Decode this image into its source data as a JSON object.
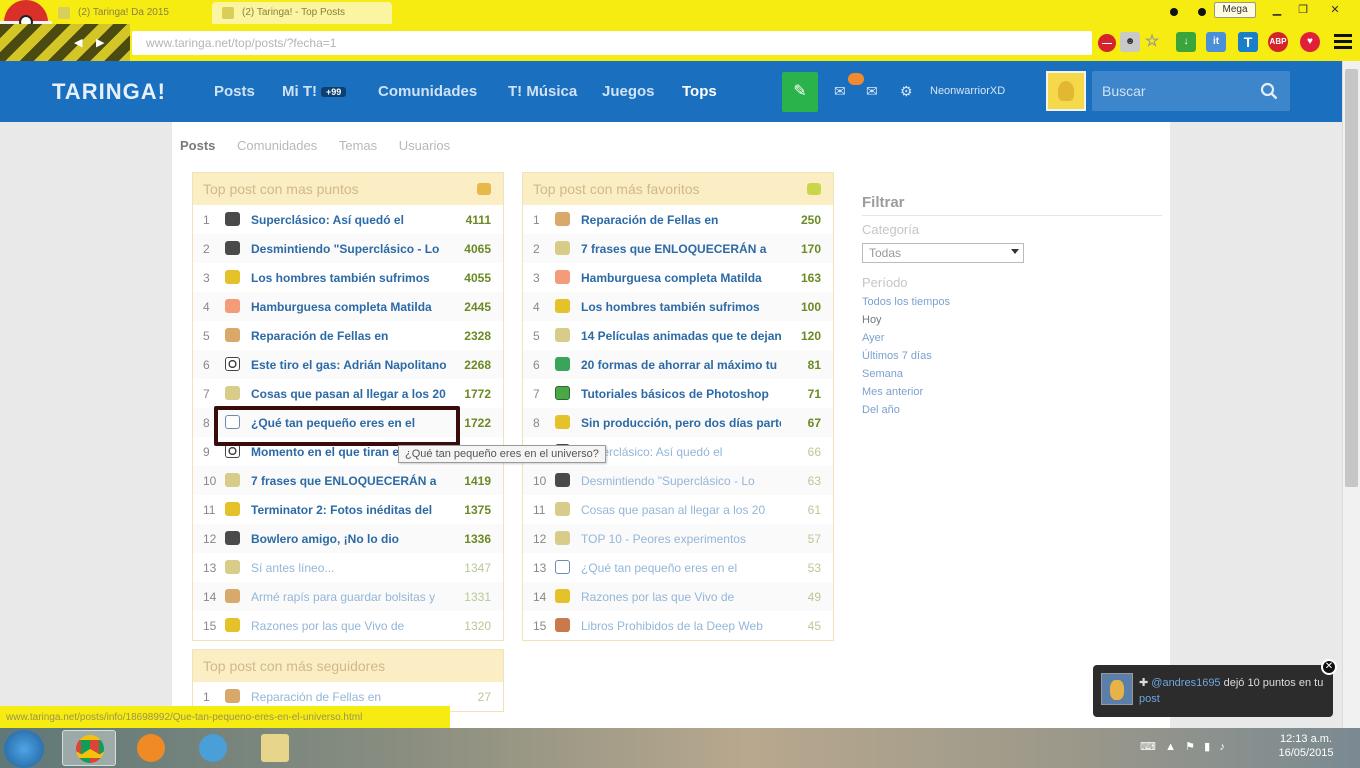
{
  "browser": {
    "tabs": [
      "(2) Taringa! Da 2015",
      "(2) Taringa! - Top Posts"
    ],
    "mega_label": "Mega",
    "url": "www.taringa.net/top/posts/?fecha=1",
    "ext_it": "it",
    "ext_t": "T",
    "ext_abp": "ABP"
  },
  "header": {
    "logo": "TARINGA!",
    "nav": [
      "Posts",
      "Mi T!",
      "Comunidades",
      "T! Música",
      "Juegos",
      "Tops"
    ],
    "mi_badge": "+99",
    "username": "NeonwarriorXD",
    "search_placeholder": "Buscar"
  },
  "subtabs": [
    "Posts",
    "Comunidades",
    "Temas",
    "Usuarios"
  ],
  "panel_points": {
    "title": "Top post con mas puntos",
    "rows": [
      {
        "n": "1",
        "icon": "film",
        "title": "Superclásico: Así quedó el",
        "pts": "4111"
      },
      {
        "n": "2",
        "icon": "film",
        "title": "Desmintiendo \"Superclásico - Lo",
        "pts": "4065"
      },
      {
        "n": "3",
        "icon": "tag",
        "title": "Los hombres también sufrimos",
        "pts": "4055"
      },
      {
        "n": "4",
        "icon": "food",
        "title": "Hamburguesa completa Matilda",
        "pts": "2445"
      },
      {
        "n": "5",
        "icon": "brush",
        "title": "Reparación de Fellas en",
        "pts": "2328"
      },
      {
        "n": "6",
        "icon": "soccer",
        "title": "Este tiro el gas: Adrián Napolitano",
        "pts": "2268"
      },
      {
        "n": "7",
        "icon": "pencil",
        "title": "Cosas que pasan al llegar a los 20",
        "pts": "1772"
      },
      {
        "n": "8",
        "icon": "book",
        "title": "¿Qué tan pequeño eres en el",
        "pts": "1722"
      },
      {
        "n": "9",
        "icon": "soccer",
        "title": "Momento en el que tiran e",
        "pts": ""
      },
      {
        "n": "10",
        "icon": "pencil",
        "title": "7 frases que ENLOQUECERÁN a",
        "pts": "1419"
      },
      {
        "n": "11",
        "icon": "tag",
        "title": "Terminator 2: Fotos inéditas del",
        "pts": "1375"
      },
      {
        "n": "12",
        "icon": "film",
        "title": "Bowlero amigo, ¡No lo dio",
        "pts": "1336"
      },
      {
        "n": "13",
        "icon": "pencil",
        "title": "Sí antes líneo...",
        "pts": "1347"
      },
      {
        "n": "14",
        "icon": "brush",
        "title": "Armé rapís para guardar bolsitas y",
        "pts": "1331"
      },
      {
        "n": "15",
        "icon": "tag",
        "title": "Razones por las que Vivo de",
        "pts": "1320"
      }
    ]
  },
  "panel_favs": {
    "title": "Top post con más favoritos",
    "rows": [
      {
        "n": "1",
        "icon": "brush",
        "title": "Reparación de Fellas en",
        "pts": "250"
      },
      {
        "n": "2",
        "icon": "pencil",
        "title": "7 frases que ENLOQUECERÁN a",
        "pts": "170"
      },
      {
        "n": "3",
        "icon": "food",
        "title": "Hamburguesa completa Matilda",
        "pts": "163"
      },
      {
        "n": "4",
        "icon": "tag",
        "title": "Los hombres también sufrimos",
        "pts": "100"
      },
      {
        "n": "5",
        "icon": "pencil",
        "title": "14 Películas animadas que te dejan",
        "pts": "120"
      },
      {
        "n": "6",
        "icon": "green",
        "title": "20 formas de ahorrar al máximo tu",
        "pts": "81"
      },
      {
        "n": "7",
        "icon": "greenbox",
        "title": "Tutoriales básicos de Photoshop",
        "pts": "71"
      },
      {
        "n": "8",
        "icon": "tag",
        "title": "Sin producción, pero dos días parte",
        "pts": "67"
      },
      {
        "n": "9",
        "icon": "film",
        "title": "Superclásico: Así quedó el",
        "pts": "66"
      },
      {
        "n": "10",
        "icon": "film",
        "title": "Desmintiendo \"Superclásico - Lo",
        "pts": "63"
      },
      {
        "n": "11",
        "icon": "pencil",
        "title": "Cosas que pasan al llegar a los 20",
        "pts": "61"
      },
      {
        "n": "12",
        "icon": "pencil",
        "title": "TOP 10 - Peores experimentos",
        "pts": "57"
      },
      {
        "n": "13",
        "icon": "book",
        "title": "¿Qué tan pequeño eres en el",
        "pts": "53"
      },
      {
        "n": "14",
        "icon": "tag",
        "title": "Razones por las que Vivo de",
        "pts": "49"
      },
      {
        "n": "15",
        "icon": "red",
        "title": "Libros Prohibidos de la Deep Web",
        "pts": "45"
      }
    ]
  },
  "panel_followers": {
    "title": "Top post con más seguidores",
    "rows": [
      {
        "n": "1",
        "icon": "brush",
        "title": "Reparación de Fellas en",
        "pts": "27"
      }
    ]
  },
  "tooltip": "¿Qué tan pequeño eres en el universo?",
  "filter": {
    "title": "Filtrar",
    "category_label": "Categoría",
    "category_value": "Todas",
    "period_label": "Período",
    "periods": [
      "Todos los tiempos",
      "Hoy",
      "Ayer",
      "Últimos 7 días",
      "Semana",
      "Mes anterior",
      "Del año"
    ],
    "current_period_index": 1
  },
  "status_url": "www.taringa.net/posts/info/18698992/Que-tan-pequeno-eres-en-el-universo.html",
  "toast": {
    "user": "@andres1695",
    "text_after": " dejó 10 puntos en tu ",
    "link": "post"
  },
  "clock": {
    "time": "12:13 a.m.",
    "date": "16/05/2015"
  }
}
